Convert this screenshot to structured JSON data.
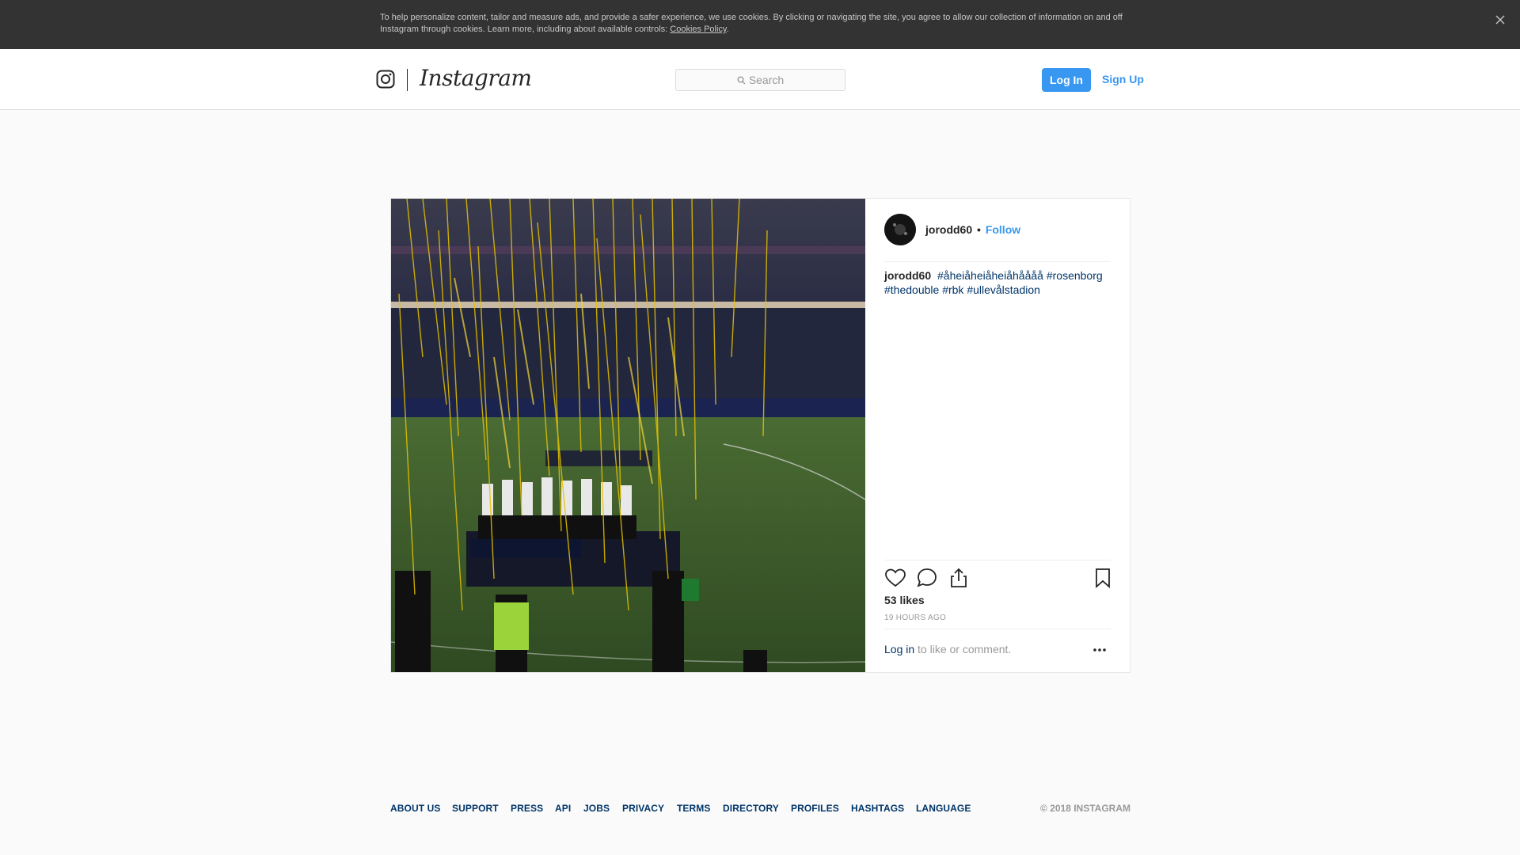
{
  "cookie_banner": {
    "text": "To help personalize content, tailor and measure ads, and provide a safer experience, we use cookies. By clicking or navigating the site, you agree to allow our collection of information on and off Instagram through cookies. Learn more, including about available controls: ",
    "link_text": "Cookies Policy",
    "suffix": ".",
    "close_icon": "close-icon"
  },
  "header": {
    "brand": "Instagram",
    "logo_icon": "instagram-camera-icon",
    "search_placeholder": "Search",
    "search_icon": "search-icon",
    "login_label": "Log In",
    "signup_label": "Sign Up"
  },
  "post": {
    "username": "jorodd60",
    "separator": "•",
    "follow_label": "Follow",
    "caption_user": "jorodd60",
    "hashtags": [
      "#åheiåheiåheiåhåååå",
      "#rosenborg",
      "#thedouble",
      "#rbk",
      "#ullevålstadion"
    ],
    "likes": "53 likes",
    "time": "19 HOURS AGO",
    "login_link": "Log in",
    "login_suffix": " to like or comment.",
    "icons": [
      "heart-icon",
      "comment-icon",
      "share-icon",
      "bookmark-icon",
      "more-options-icon"
    ]
  },
  "footer": {
    "links": [
      "ABOUT US",
      "SUPPORT",
      "PRESS",
      "API",
      "JOBS",
      "PRIVACY",
      "TERMS",
      "DIRECTORY",
      "PROFILES",
      "HASHTAGS",
      "LANGUAGE"
    ],
    "copyright": "© 2018 INSTAGRAM"
  },
  "colors": {
    "accent": "#3897f0",
    "link_dark": "#003569",
    "cookie_bg": "#333333",
    "page_bg": "#fafafa"
  }
}
